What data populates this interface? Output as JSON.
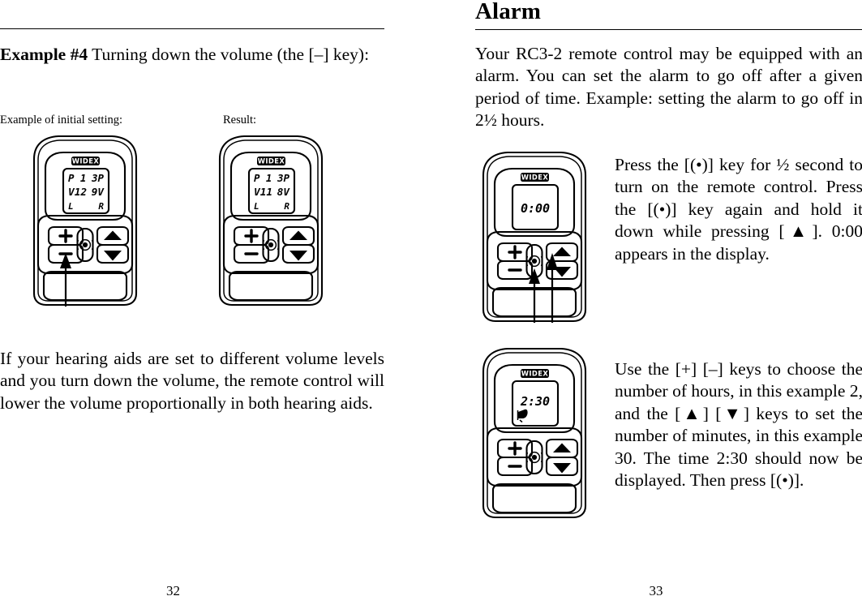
{
  "document": {
    "type": "user-guide-spread",
    "product": "RC3-2 remote control",
    "brand": "WIDEX"
  },
  "left_page": {
    "folio": "32",
    "example_heading_lead": "Example #4",
    "example_heading_rest": " Turning down the volume (the [–] key):",
    "caption_initial": "Example of initial setting:",
    "caption_result": "Result:",
    "closing_paragraph": "If your hearing aids are set to different volume levels and you turn down the volume, the remote control will lower the volume proportionally in both hear­ing aids.",
    "device_initial": {
      "name": "remote-initial-setting",
      "logo": "WIDEX",
      "lcd": {
        "row1_left": "P 1",
        "row1_right": "3P",
        "row2_left": "V12",
        "row2_right": "9V",
        "row3_left": "L",
        "row3_right": "R"
      },
      "keys": {
        "plus": "+",
        "minus": "–",
        "center": "(•)",
        "up": "▲",
        "down": "▼"
      },
      "pointer_target": "minus-key"
    },
    "device_result": {
      "name": "remote-result",
      "logo": "WIDEX",
      "lcd": {
        "row1_left": "P 1",
        "row1_right": "3P",
        "row2_left": "V11",
        "row2_right": "8V",
        "row3_left": "L",
        "row3_right": "R"
      },
      "keys": {
        "plus": "+",
        "minus": "–",
        "center": "(•)",
        "up": "▲",
        "down": "▼"
      },
      "pointer_target": "none"
    }
  },
  "right_page": {
    "folio": "33",
    "chapter_title": "Alarm",
    "intro_paragraph": "Your RC3-2 remote control may be equipped with an alarm. You can set the alarm to go off after a giv­en period of time. Example: setting the alarm to go off in 2½ hours.",
    "step1_paragraph": "Press the [(•)] key for ½ second to turn on the remote control. Press the [(•)] key again and hold it down while pressing [▲]. 0:00 appears in the display.",
    "step2_paragraph": "Use the [+] [–] keys to choose the number of hours, in this ex­ample 2, and the [▲] [▼] keys to set the number of minutes, in this example 30. The time 2:30 should now be displayed. Then press [(•)].",
    "device_alarm_start": {
      "name": "remote-alarm-zero",
      "logo": "WIDEX",
      "lcd": {
        "time": "0:00",
        "bell": false
      },
      "keys": {
        "plus": "+",
        "minus": "–",
        "center": "(•)",
        "up": "▲",
        "down": "▼"
      },
      "pointer_targets": [
        "center-key",
        "up-key"
      ]
    },
    "device_alarm_set": {
      "name": "remote-alarm-set",
      "logo": "WIDEX",
      "lcd": {
        "time": "2:30",
        "bell": true
      },
      "keys": {
        "plus": "+",
        "minus": "–",
        "center": "(•)",
        "up": "▲",
        "down": "▼"
      },
      "pointer_targets": []
    }
  },
  "colors": {
    "ink": "#000000",
    "paper": "#ffffff",
    "logo_plate": "#000000",
    "logo_text": "#ffffff"
  }
}
